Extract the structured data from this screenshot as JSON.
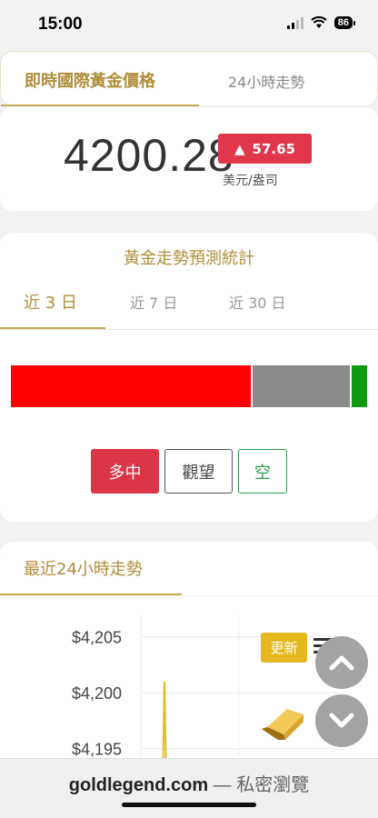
{
  "status": {
    "time": "15:00",
    "battery": "86"
  },
  "tabs": {
    "active_label": "即時國際黃金價格",
    "other_label": "24小時走勢"
  },
  "price": {
    "value": "4200.28",
    "change_arrow": "▲",
    "change": "57.65",
    "unit": "美元/盎司"
  },
  "forecast": {
    "title": "黃金走勢預測統計",
    "ranges": [
      "近 3 日",
      "近 7 日",
      "近 30 日"
    ],
    "active_range": "近 3 日",
    "distribution": [
      {
        "label": "多中",
        "fraction": 0.68,
        "color": "#ff0000"
      },
      {
        "label": "觀望",
        "fraction": 0.275,
        "color": "#8a8a8a"
      },
      {
        "label": "空",
        "fraction": 0.045,
        "color": "#119911"
      }
    ],
    "buttons": {
      "bull": "多中",
      "wait": "觀望",
      "bear": "空"
    }
  },
  "trend": {
    "title": "最近24小時走勢",
    "refresh_label": "更新"
  },
  "chart_data": {
    "type": "line",
    "title": "",
    "xlabel": "",
    "ylabel": "",
    "ytick_labels": [
      "$4,205",
      "$4,200",
      "$4,195"
    ],
    "yticks": [
      4205,
      4200,
      4195
    ],
    "ylim": [
      4194,
      4207
    ],
    "grid": true,
    "series": [
      {
        "values": [
          4194,
          4194,
          4201,
          4194
        ]
      }
    ]
  },
  "url_bar": {
    "domain": "goldlegend.com",
    "mode": "— 私密瀏覽"
  },
  "icons": {
    "refresh": "refresh-button",
    "menu": "menu-icon",
    "scroll_up": "chevron-up-icon",
    "scroll_down": "chevron-down-icon",
    "gold": "gold-bar-icon"
  }
}
